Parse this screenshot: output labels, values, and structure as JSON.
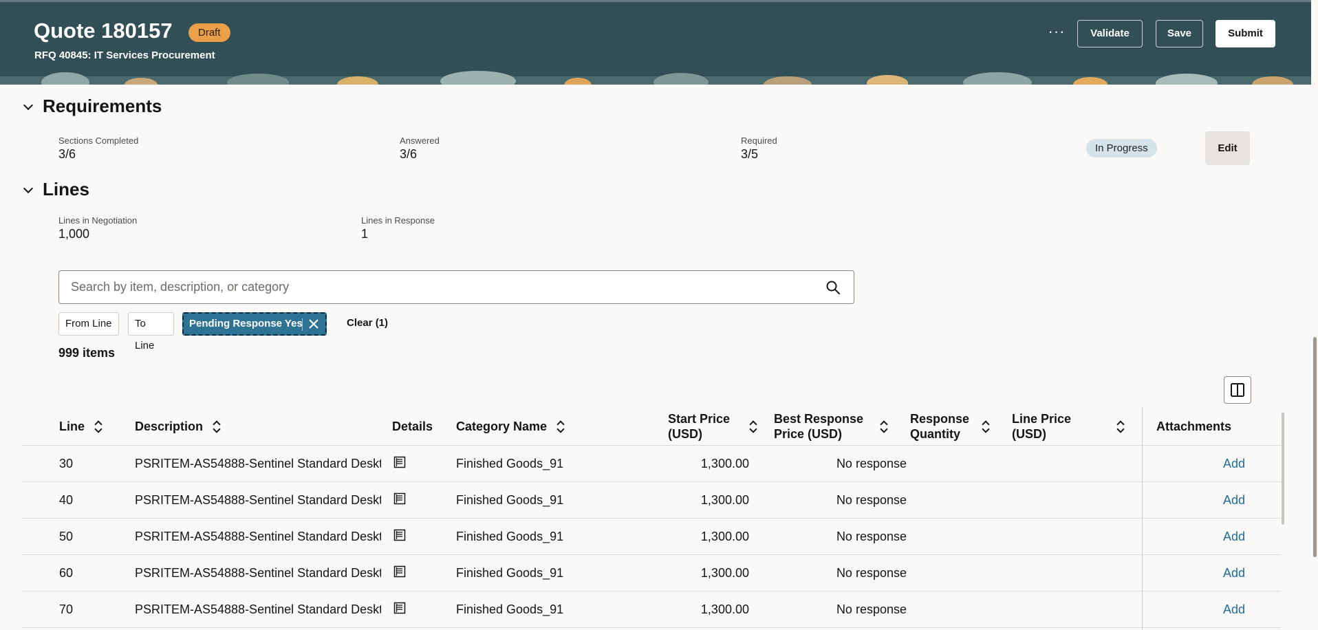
{
  "header": {
    "title": "Quote 180157",
    "status_badge": "Draft",
    "subtitle": "RFQ 40845: IT Services Procurement",
    "more_label": "···",
    "validate_label": "Validate",
    "save_label": "Save",
    "submit_label": "Submit",
    "colors": {
      "background": "#324f56",
      "badge": "#e9a048"
    }
  },
  "requirements": {
    "title": "Requirements",
    "stats": [
      {
        "label": "Sections Completed",
        "value": "3/6"
      },
      {
        "label": "Answered",
        "value": "3/6"
      },
      {
        "label": "Required",
        "value": "3/5"
      }
    ],
    "status": "In Progress",
    "edit_label": "Edit"
  },
  "lines": {
    "title": "Lines",
    "stats": [
      {
        "label": "Lines in Negotiation",
        "value": "1,000"
      },
      {
        "label": "Lines in Response",
        "value": "1"
      }
    ],
    "search": {
      "placeholder": "Search by item, description, or category",
      "icon": "search-icon"
    },
    "filters": {
      "from_line": "From Line",
      "to_line": "To Line",
      "active": "Pending Response Yes",
      "clear": "Clear (1)"
    },
    "count": "999 items",
    "table": {
      "headers": {
        "line": "Line",
        "description": "Description",
        "details": "Details",
        "category": "Category Name",
        "start_price_1": "Start Price",
        "start_price_2": "(USD)",
        "best_price_1": "Best Response",
        "best_price_2": "Price (USD)",
        "resp_qty_1": "Response",
        "resp_qty_2": "Quantity",
        "line_price_1": "Line Price",
        "line_price_2": "(USD)",
        "attachments": "Attachments"
      },
      "rows": [
        {
          "line": "30",
          "description": "PSRITEM-AS54888-Sentinel Standard Deskt",
          "category": "Finished Goods_91",
          "start_price": "1,300.00",
          "best_price": "No response",
          "attachments": "Add"
        },
        {
          "line": "40",
          "description": "PSRITEM-AS54888-Sentinel Standard Deskt",
          "category": "Finished Goods_91",
          "start_price": "1,300.00",
          "best_price": "No response",
          "attachments": "Add"
        },
        {
          "line": "50",
          "description": "PSRITEM-AS54888-Sentinel Standard Deskt",
          "category": "Finished Goods_91",
          "start_price": "1,300.00",
          "best_price": "No response",
          "attachments": "Add"
        },
        {
          "line": "60",
          "description": "PSRITEM-AS54888-Sentinel Standard Deskt",
          "category": "Finished Goods_91",
          "start_price": "1,300.00",
          "best_price": "No response",
          "attachments": "Add"
        },
        {
          "line": "70",
          "description": "PSRITEM-AS54888-Sentinel Standard Deskt",
          "category": "Finished Goods_91",
          "start_price": "1,300.00",
          "best_price": "No response",
          "attachments": "Add"
        }
      ]
    }
  }
}
